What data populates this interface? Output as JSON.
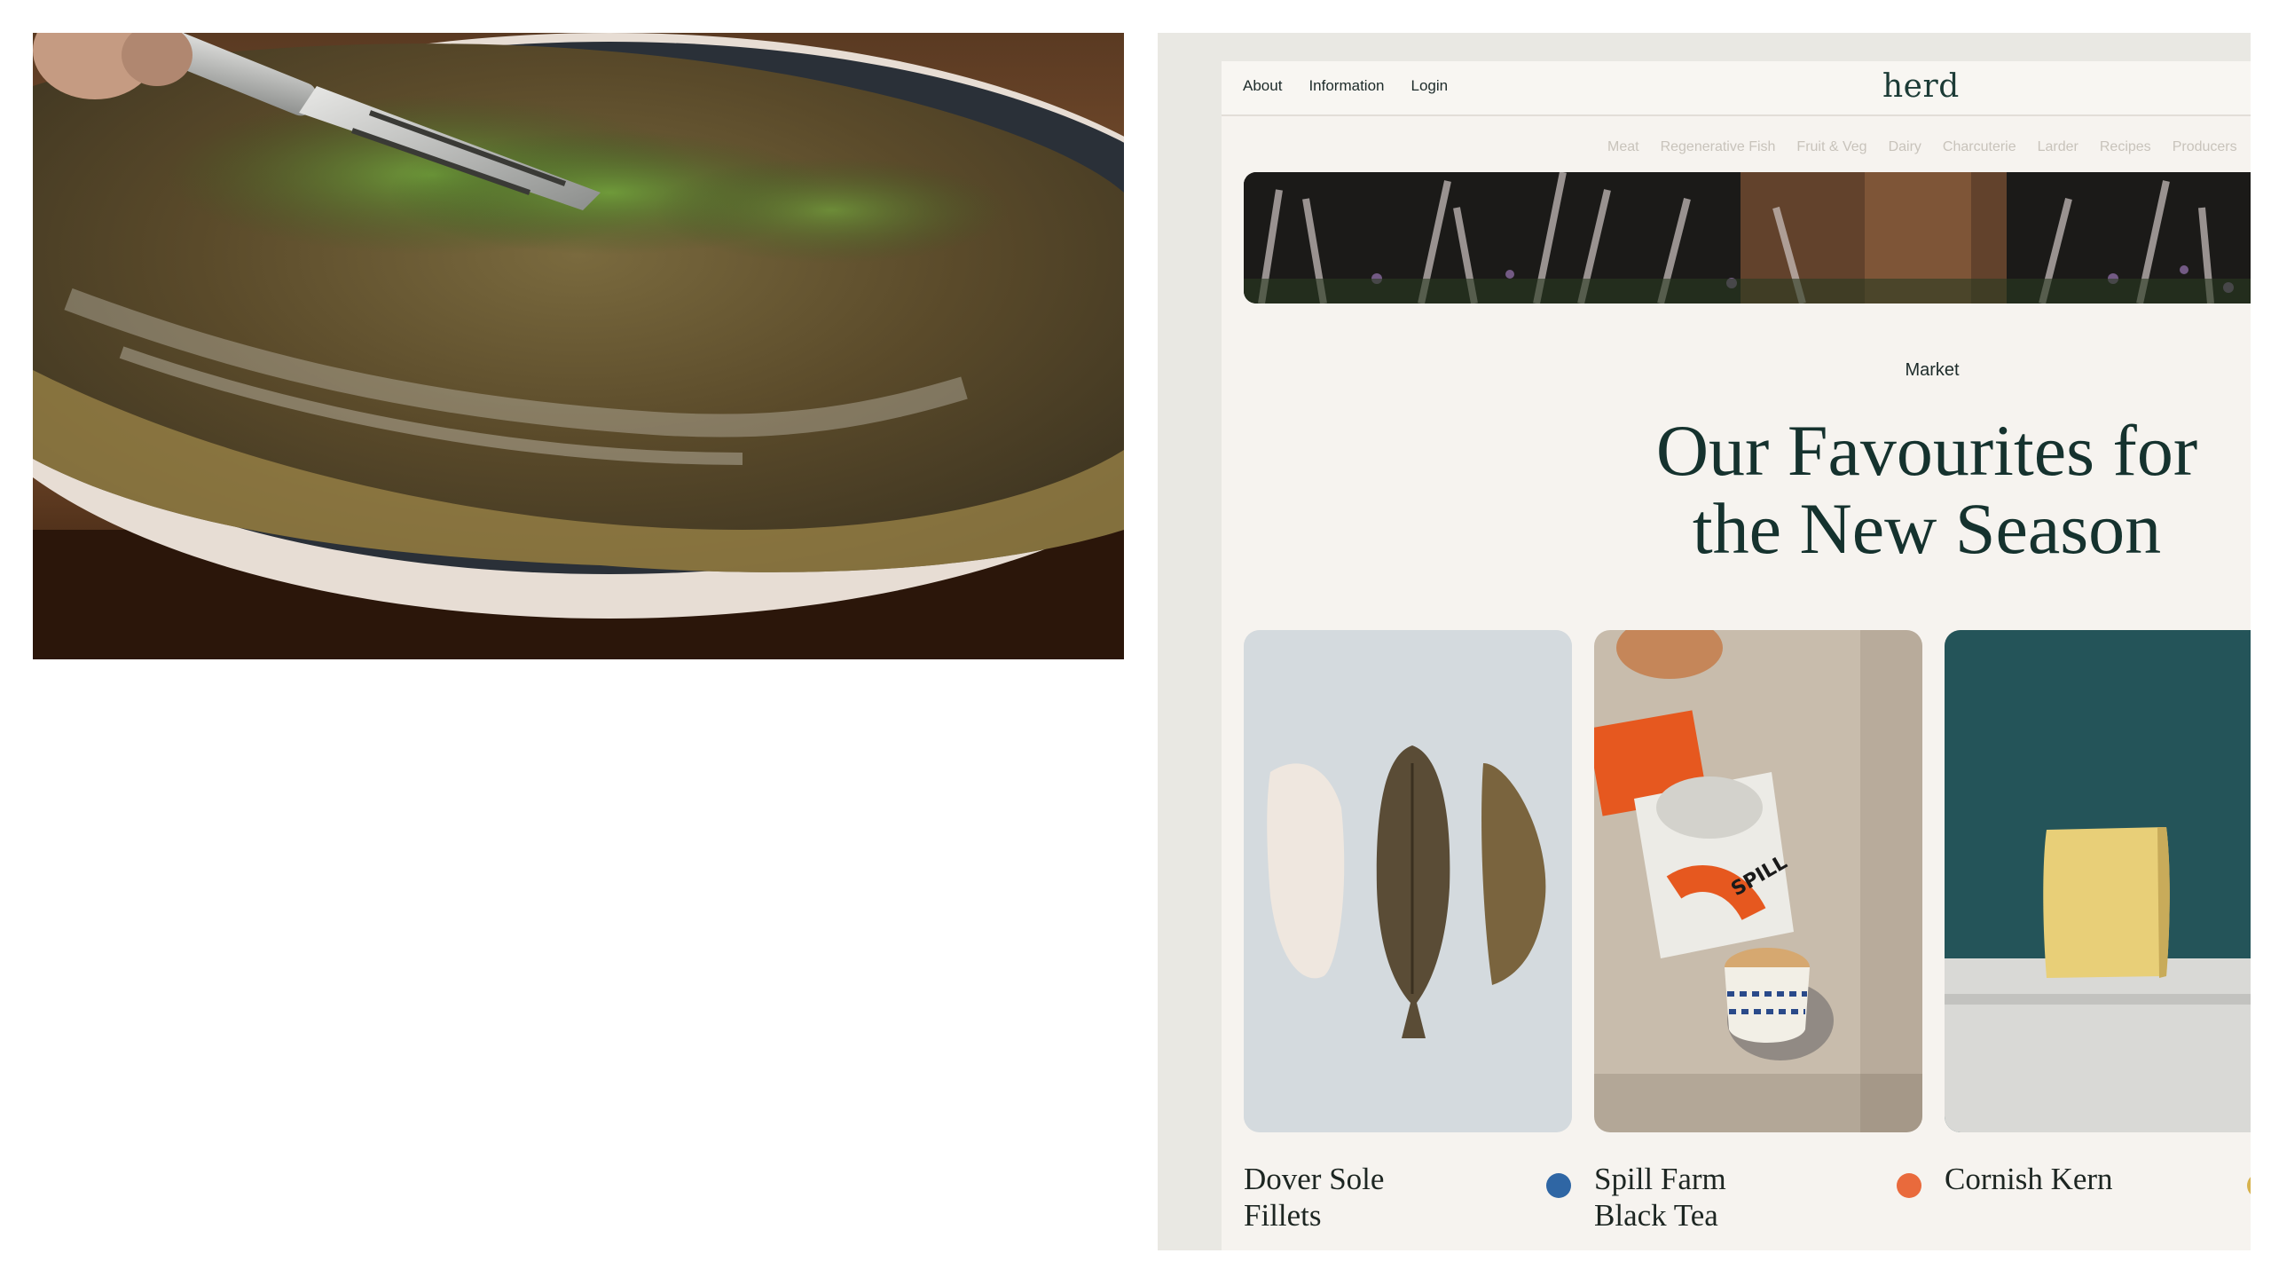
{
  "site": {
    "nav": [
      "About",
      "Information",
      "Login"
    ],
    "logo": "herd",
    "categories": [
      "Meat",
      "Regenerative Fish",
      "Fruit & Veg",
      "Dairy",
      "Charcuterie",
      "Larder",
      "Recipes",
      "Producers"
    ],
    "eyebrow": "Market",
    "headline_line1": "Our Favourites for",
    "headline_line2": "the New Season"
  },
  "products": [
    {
      "name": "Dover Sole Fillets",
      "name_line1": "Dover Sole",
      "name_line2": "Fillets",
      "dot_color": "#2f66a4"
    },
    {
      "name": "Spill Farm Black Tea",
      "name_line1": "Spill Farm",
      "name_line2": "Black Tea",
      "dot_color": "#e96a3c",
      "tin_text": "SPILL"
    },
    {
      "name": "Cornish Kern",
      "name_line1": "Cornish Kern",
      "name_line2": "",
      "dot_color": "#d7b24d"
    }
  ],
  "colors": {
    "headline": "#15322e",
    "site_bg": "#f6f3ef",
    "frame_bg": "#e9e8e3"
  }
}
